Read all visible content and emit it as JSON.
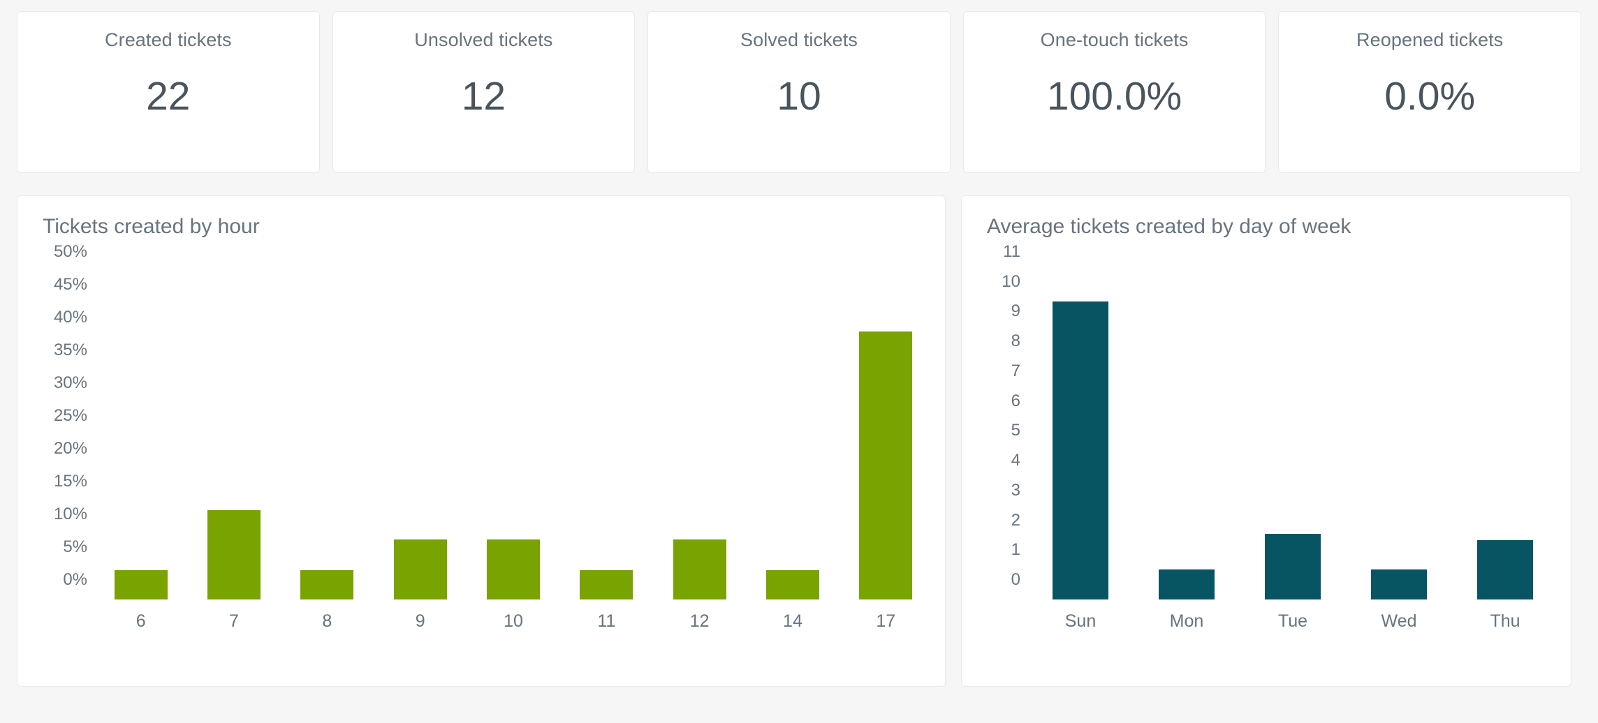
{
  "theme": {
    "page_background": "#f6f6f6",
    "card_background": "#ffffff",
    "card_border": "#e9e9e9",
    "text_muted": "#68737d",
    "text_value": "#49545c",
    "bar_green": "#78a300",
    "bar_teal": "#075462"
  },
  "kpis": [
    {
      "label": "Created tickets",
      "value": "22"
    },
    {
      "label": "Unsolved tickets",
      "value": "12"
    },
    {
      "label": "Solved tickets",
      "value": "10"
    },
    {
      "label": "One-touch tickets",
      "value": "100.0%"
    },
    {
      "label": "Reopened tickets",
      "value": "0.0%"
    }
  ],
  "charts": {
    "hour": {
      "title": "Tickets created by hour"
    },
    "dow": {
      "title": "Average tickets created by day of week"
    }
  },
  "chart_data": [
    {
      "type": "bar",
      "title": "Tickets created by hour",
      "xlabel": "",
      "ylabel": "",
      "categories": [
        "6",
        "7",
        "8",
        "9",
        "10",
        "11",
        "12",
        "14",
        "17"
      ],
      "values": [
        4.5,
        13.6,
        4.5,
        9.1,
        9.1,
        4.5,
        9.1,
        4.5,
        40.9
      ],
      "value_format": "percent",
      "ylim": [
        0,
        50
      ],
      "yticks": [
        0,
        5,
        10,
        15,
        20,
        25,
        30,
        35,
        40,
        45,
        50
      ],
      "ytick_labels": [
        "0%",
        "5%",
        "10%",
        "15%",
        "20%",
        "25%",
        "30%",
        "35%",
        "40%",
        "45%",
        "50%"
      ],
      "grid": false,
      "legend": false,
      "bar_color": "#78a300"
    },
    {
      "type": "bar",
      "title": "Average tickets created by day of week",
      "xlabel": "",
      "ylabel": "",
      "categories": [
        "Sun",
        "Mon",
        "Tue",
        "Wed",
        "Thu"
      ],
      "values": [
        10,
        1,
        2.2,
        1,
        2
      ],
      "value_format": "count",
      "ylim": [
        0,
        11
      ],
      "yticks": [
        0,
        1,
        2,
        3,
        4,
        5,
        6,
        7,
        8,
        9,
        10,
        11
      ],
      "ytick_labels": [
        "0",
        "1",
        "2",
        "3",
        "4",
        "5",
        "6",
        "7",
        "8",
        "9",
        "10",
        "11"
      ],
      "grid": false,
      "legend": false,
      "bar_color": "#075462"
    }
  ]
}
